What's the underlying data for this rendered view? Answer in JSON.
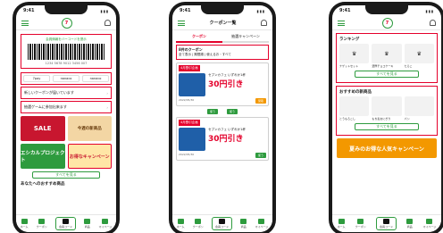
{
  "status_time": "9:41",
  "logo_text": "7",
  "left": {
    "member_head": "会員情報をバーコードを提示",
    "member_number": "1234 5678 9012 3456 007",
    "pay": [
      "7pay",
      "nanaco",
      "nanaco"
    ],
    "notice1": "新しいクーポンが届いています",
    "notice2": "抽選ゲームに参加出来ます",
    "tile_sale": "SALE",
    "tile_new": "今週の新商品",
    "tile_eco": "エシカルプロジェクト",
    "tile_camp": "お得なキャンペーン",
    "more_btn": "すべてを見る",
    "section": "あなたへのおすすめ商品"
  },
  "middle": {
    "title": "クーポン一覧",
    "tab1": "クーポン",
    "tab2": "抽選キャンペーン",
    "subtabs": "全て表示 | 期限順 | 使えるお・すべて",
    "count": "8件のクーポン",
    "coupons": [
      {
        "label": "4月割引企画",
        "text": "セブンカフェ いずれか1杯",
        "price": "30円引き",
        "date": "2022/05/30"
      },
      {
        "label": "4月割引企画",
        "text": "セブンカフェ いずれか1杯",
        "price": "30円引き",
        "date": "2022/05/30"
      }
    ],
    "use": "使う",
    "use_alt": "受取"
  },
  "right": {
    "title": "ランキング",
    "rank_items": [
      "ナゲットセット",
      "濃厚チョコケーキ",
      "たらこ"
    ],
    "more_btn": "すべてを見る",
    "section": "おすすめの新商品",
    "new_items": [
      "とうもろこし",
      "もち麦おにぎり",
      "パン"
    ],
    "banner": "夏みのお得な人気キャンペーン"
  },
  "nav": [
    "ホーム",
    "クーポン",
    "会員コード",
    "商品",
    "マイページ"
  ]
}
